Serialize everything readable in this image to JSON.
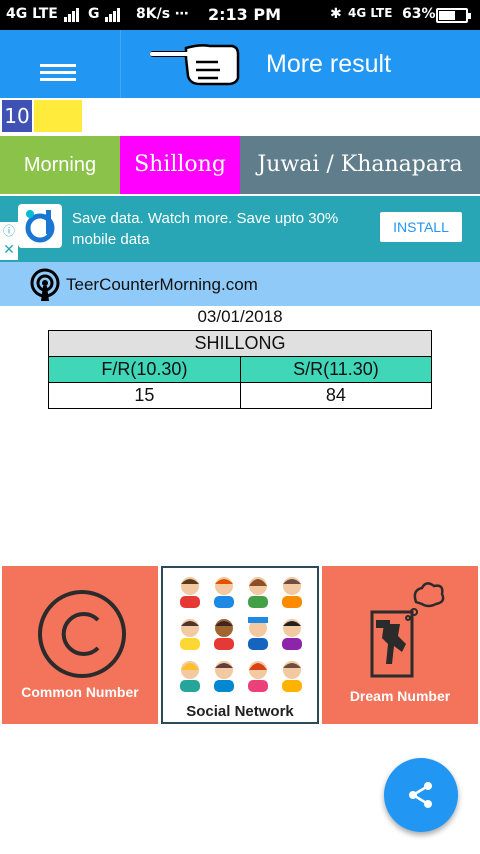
{
  "status_bar": {
    "signal1": "4G LTE",
    "signal2": "G",
    "speed": "8K/s ⋯",
    "time": "2:13 PM",
    "network": "4G LTE",
    "battery": "63%",
    "battery_level": 0.63
  },
  "app_bar": {
    "title": "More result",
    "menu_icon": "hamburger-menu-icon",
    "hand_icon": "pointing-hand-icon"
  },
  "number_strip": {
    "number": "10"
  },
  "tabs": [
    {
      "label": "Morning",
      "color": "#8bc34a"
    },
    {
      "label": "Shillong",
      "color": "#ff00ff"
    },
    {
      "label": "Juwai / Khanapara",
      "color": "#607d8b"
    }
  ],
  "ad": {
    "text": "Save data. Watch more. Save upto 30% mobile data",
    "button": "INSTALL",
    "info_icon": "ⓘ",
    "close_icon": "✕"
  },
  "site": {
    "name": "TeerCounterMorning.com"
  },
  "result": {
    "date": "03/01/2018",
    "title": "SHILLONG",
    "headers": [
      "F/R(10.30)",
      "S/R(11.30)"
    ],
    "values": [
      "15",
      "84"
    ]
  },
  "tiles": [
    {
      "label": "Common Number",
      "icon": "copyright-icon"
    },
    {
      "label": "Social Network",
      "icon": "people-group-icon"
    },
    {
      "label": "Dream Number",
      "icon": "dream-icon"
    }
  ],
  "colors": {
    "primary": "#2196f3",
    "tile": "#f4735b",
    "table_header": "#40d6b8",
    "ad_bg": "#29a6b5",
    "site_bg": "#90caf9"
  }
}
